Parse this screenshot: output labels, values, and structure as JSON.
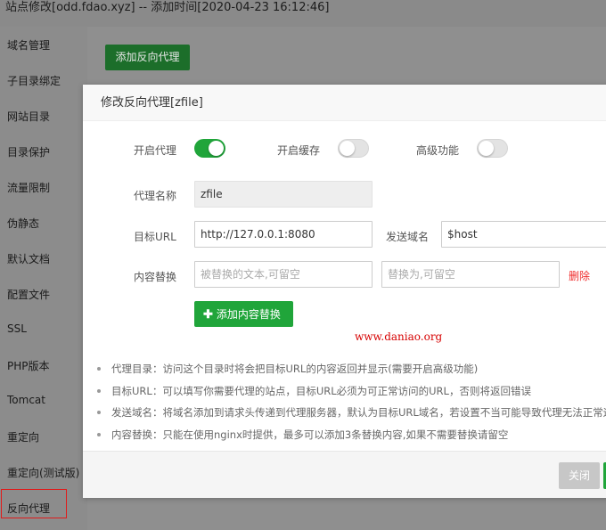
{
  "window": {
    "title": "站点修改[odd.fdao.xyz] -- 添加时间[2020-04-23 16:12:46]"
  },
  "sidebar": {
    "items": [
      {
        "label": "域名管理"
      },
      {
        "label": "子目录绑定"
      },
      {
        "label": "网站目录"
      },
      {
        "label": "目录保护"
      },
      {
        "label": "流量限制"
      },
      {
        "label": "伪静态"
      },
      {
        "label": "默认文档"
      },
      {
        "label": "配置文件"
      },
      {
        "label": "SSL"
      },
      {
        "label": "PHP版本"
      },
      {
        "label": "Tomcat"
      },
      {
        "label": "重定向"
      },
      {
        "label": "重定向(测试版)"
      },
      {
        "label": "反向代理",
        "active": true
      }
    ]
  },
  "content": {
    "add_proxy_label": "添加反向代理"
  },
  "modal": {
    "title": "修改反向代理[zfile]",
    "toggles": {
      "enable_proxy": {
        "label": "开启代理",
        "on": true
      },
      "enable_cache": {
        "label": "开启缓存",
        "on": false
      },
      "advanced": {
        "label": "高级功能",
        "on": false
      }
    },
    "proxy_name": {
      "label": "代理名称",
      "value": "zfile"
    },
    "target_url": {
      "label": "目标URL",
      "value": "http://127.0.0.1:8080"
    },
    "send_domain": {
      "label": "发送域名",
      "value": "$host"
    },
    "content_replace": {
      "label": "内容替换",
      "from_placeholder": "被替换的文本,可留空",
      "to_placeholder": "替换为,可留空",
      "delete_label": "删除"
    },
    "add_replace_label": "添加内容替换",
    "watermark": "www.daniao.org",
    "tips": [
      "代理目录：访问这个目录时将会把目标URL的内容返回并显示(需要开启高级功能)",
      "目标URL：可以填写你需要代理的站点，目标URL必须为可正常访问的URL，否则将返回错误",
      "发送域名：将域名添加到请求头传递到代理服务器，默认为目标URL域名，若设置不当可能导致代理无法正常运行",
      "内容替换：只能在使用nginx时提供，最多可以添加3条替换内容,如果不需要替换请留空"
    ],
    "footer": {
      "close_label": "关闭"
    }
  },
  "colors": {
    "accent": "#20a53a",
    "danger": "#ef2b2b",
    "highlight_box": "#e01b1b"
  }
}
